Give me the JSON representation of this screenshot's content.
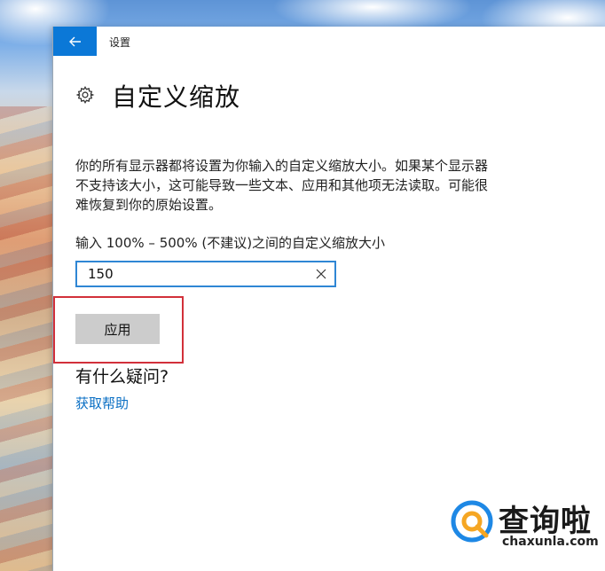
{
  "window": {
    "title": "设置",
    "back_icon": "back-arrow-icon"
  },
  "page": {
    "title": "自定义缩放",
    "icon": "gear-icon",
    "description": "你的所有显示器都将设置为你输入的自定义缩放大小。如果某个显示器不支持该大小，这可能导致一些文本、应用和其他项无法读取。可能很难恢复到你的原始设置。"
  },
  "scale_input": {
    "label": "输入 100% – 500% (不建议)之间的自定义缩放大小",
    "value": "150",
    "clear_icon": "close-icon"
  },
  "apply_button": {
    "label": "应用"
  },
  "help": {
    "heading": "有什么疑问?",
    "link": "获取帮助"
  },
  "watermark": {
    "title": "查询啦",
    "url": "chaxunla.com"
  },
  "colors": {
    "accent": "#0b78d7",
    "highlight": "#d2303a",
    "link": "#0a6fc4"
  }
}
